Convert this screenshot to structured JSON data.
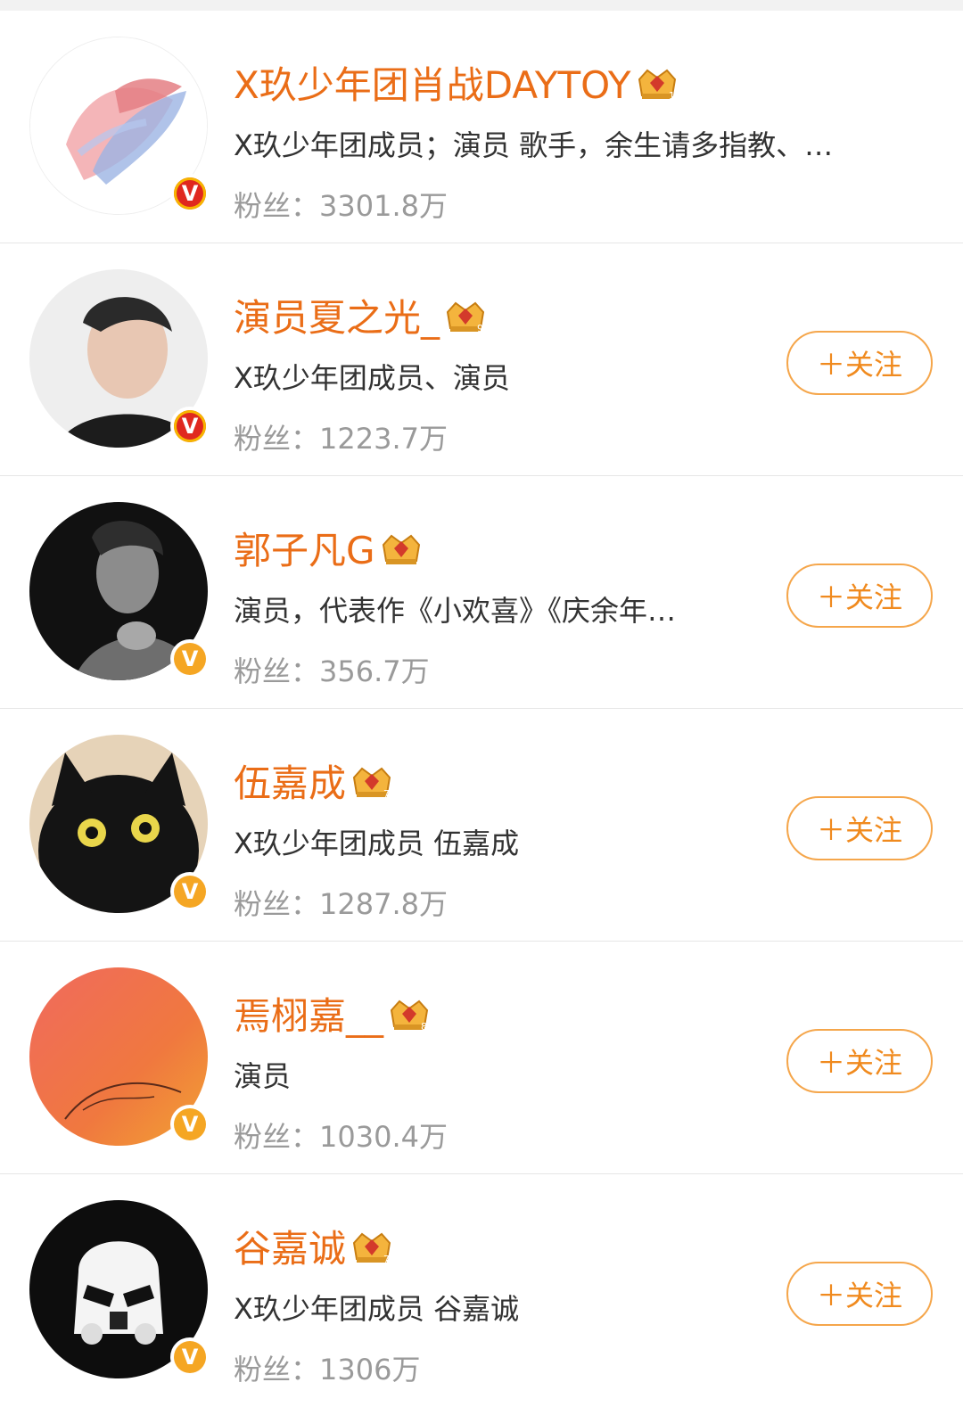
{
  "users": [
    {
      "name": "X玖少年团肖战DAYTOY",
      "crown_level": "10",
      "verified": "red",
      "desc": "X玖少年团成员；演员 歌手，余生请多指教、…",
      "fans_label": "粉丝：",
      "fans_value": "3301.8万",
      "follow_label": ""
    },
    {
      "name": "演员夏之光_",
      "crown_level": "9",
      "verified": "red",
      "desc": "X玖少年团成员、演员",
      "fans_label": "粉丝：",
      "fans_value": "1223.7万",
      "follow_label": "＋关注"
    },
    {
      "name": "郭子凡G",
      "crown_level": "",
      "verified": "orange",
      "desc": "演员，代表作《小欢喜》《庆余年…",
      "fans_label": "粉丝：",
      "fans_value": "356.7万",
      "follow_label": "＋关注"
    },
    {
      "name": "伍嘉成",
      "crown_level": "7",
      "verified": "orange",
      "desc": "X玖少年团成员 伍嘉成",
      "fans_label": "粉丝：",
      "fans_value": "1287.8万",
      "follow_label": "＋关注"
    },
    {
      "name": "焉栩嘉__",
      "crown_level": "8",
      "verified": "orange",
      "desc": "演员",
      "fans_label": "粉丝：",
      "fans_value": "1030.4万",
      "follow_label": "＋关注"
    },
    {
      "name": "谷嘉诚",
      "crown_level": "7",
      "verified": "orange",
      "desc": "X玖少年团成员 谷嘉诚",
      "fans_label": "粉丝：",
      "fans_value": "1306万",
      "follow_label": "＋关注"
    }
  ],
  "icons": {
    "verified_badge_glyph": "V",
    "crown_icon": "crown-icon",
    "accent_color": "#ea6d17"
  }
}
